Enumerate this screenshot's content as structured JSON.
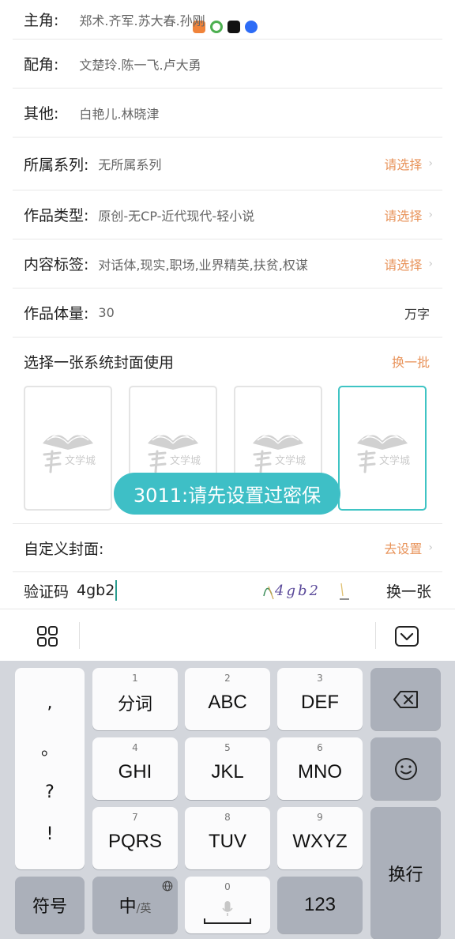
{
  "roles": {
    "lead": {
      "label": "主角:",
      "value": "郑术.齐军.苏大春.孙刚"
    },
    "support": {
      "label": "配角:",
      "value": "文楚玲.陈一飞.卢大勇"
    },
    "other": {
      "label": "其他:",
      "value": "白艳儿.林晓津"
    }
  },
  "series": {
    "label": "所属系列:",
    "value": "无所属系列",
    "action": "请选择"
  },
  "work_type": {
    "label": "作品类型:",
    "value": "原创-无CP-近代现代-轻小说",
    "action": "请选择"
  },
  "tags": {
    "label": "内容标签:",
    "value": "对话体,现实,职场,业界精英,扶贫,权谋",
    "action": "请选择"
  },
  "volume": {
    "label": "作品体量:",
    "value": "30",
    "unit": "万字"
  },
  "cover_select": {
    "title": "选择一张系统封面使用",
    "refresh": "换一批",
    "selected_index": 3
  },
  "cover_logo_text": "文学城",
  "toast": "3011:请先设置过密保",
  "custom_cover": {
    "label": "自定义封面:",
    "action": "去设置"
  },
  "captcha": {
    "label": "验证码",
    "value": "4gb2",
    "image_text": "4gb2",
    "swap": "换一张"
  },
  "keyboard": {
    "punct": [
      ",",
      "。",
      "?",
      "!"
    ],
    "rows": [
      [
        {
          "num": "1",
          "label": "分词"
        },
        {
          "num": "2",
          "label": "ABC"
        },
        {
          "num": "3",
          "label": "DEF"
        }
      ],
      [
        {
          "num": "4",
          "label": "GHI"
        },
        {
          "num": "5",
          "label": "JKL"
        },
        {
          "num": "6",
          "label": "MNO"
        }
      ],
      [
        {
          "num": "7",
          "label": "PQRS"
        },
        {
          "num": "8",
          "label": "TUV"
        },
        {
          "num": "9",
          "label": "WXYZ"
        }
      ]
    ],
    "symbols": "符号",
    "lang_main": "中",
    "lang_sub": "/英",
    "space_num": "0",
    "num_key": "123",
    "enter": "换行"
  },
  "colors": {
    "accent": "#e8935a",
    "teal": "#3ebfc6"
  }
}
